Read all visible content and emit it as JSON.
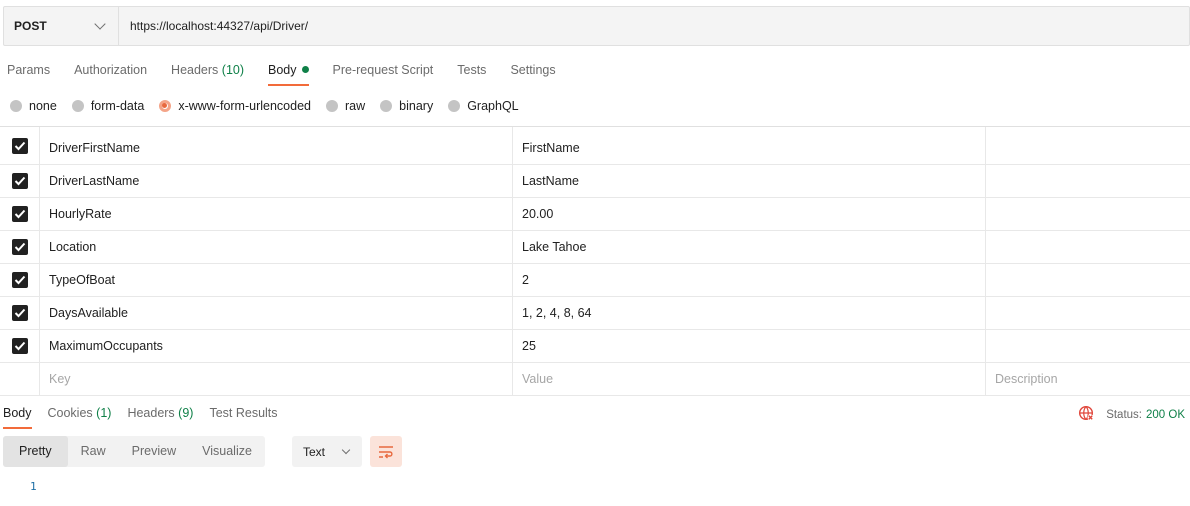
{
  "request": {
    "method": "POST",
    "url": "https://localhost:44327/api/Driver/"
  },
  "request_tabs": [
    {
      "label": "Params"
    },
    {
      "label": "Authorization"
    },
    {
      "label": "Headers",
      "count": "(10)"
    },
    {
      "label": "Body",
      "active": true
    },
    {
      "label": "Pre-request Script"
    },
    {
      "label": "Tests"
    },
    {
      "label": "Settings"
    }
  ],
  "body_types": [
    {
      "label": "none",
      "selected": false
    },
    {
      "label": "form-data",
      "selected": false
    },
    {
      "label": "x-www-form-urlencoded",
      "selected": true
    },
    {
      "label": "raw",
      "selected": false
    },
    {
      "label": "binary",
      "selected": false
    },
    {
      "label": "GraphQL",
      "selected": false
    }
  ],
  "params": [
    {
      "checked": true,
      "key": "DriverFirstName",
      "value": "FirstName",
      "description": ""
    },
    {
      "checked": true,
      "key": "DriverLastName",
      "value": "LastName",
      "description": ""
    },
    {
      "checked": true,
      "key": "HourlyRate",
      "value": "20.00",
      "description": ""
    },
    {
      "checked": true,
      "key": "Location",
      "value": "Lake Tahoe",
      "description": ""
    },
    {
      "checked": true,
      "key": "TypeOfBoat",
      "value": "2",
      "description": ""
    },
    {
      "checked": true,
      "key": "DaysAvailable",
      "value": "1, 2, 4, 8, 64",
      "description": ""
    },
    {
      "checked": true,
      "key": "MaximumOccupants",
      "value": "25",
      "description": ""
    }
  ],
  "new_row": {
    "key_placeholder": "Key",
    "value_placeholder": "Value",
    "description_placeholder": "Description"
  },
  "response_tabs": [
    {
      "label": "Body",
      "active": true
    },
    {
      "label": "Cookies",
      "count": "(1)"
    },
    {
      "label": "Headers",
      "count": "(9)"
    },
    {
      "label": "Test Results"
    }
  ],
  "status": {
    "label": "Status:",
    "code": "200 OK"
  },
  "format_buttons": [
    {
      "label": "Pretty",
      "active": true
    },
    {
      "label": "Raw"
    },
    {
      "label": "Preview"
    },
    {
      "label": "Visualize"
    }
  ],
  "format_type": "Text",
  "line_numbers": [
    "1"
  ],
  "colors": {
    "accent": "#f26b3a",
    "success": "#0f8048",
    "globe_icon": "#e0453a"
  }
}
